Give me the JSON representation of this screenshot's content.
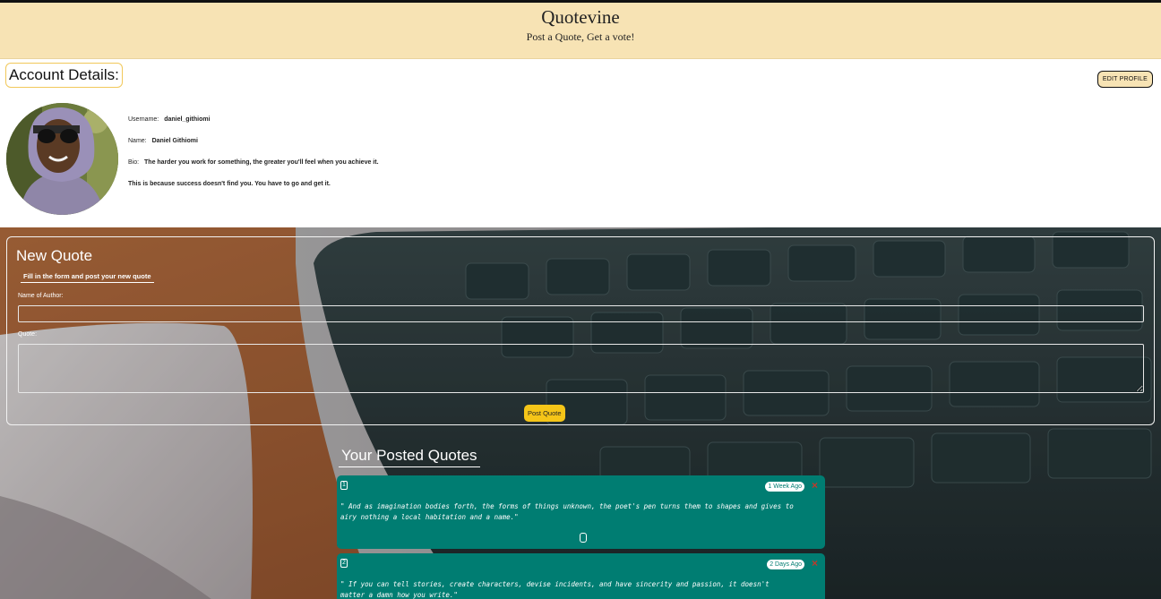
{
  "header": {
    "title": "Quotevine",
    "tagline": "Post a Quote, Get a vote!"
  },
  "account": {
    "heading": "Account Details:",
    "edit_button": "EDIT PROFILE",
    "username_label": "Username:",
    "username": "daniel_githiomi",
    "name_label": "Name:",
    "name": "Daniel Githiomi",
    "bio_label": "Bio:",
    "bio_line1": "The harder you work for something, the greater you'll feel when you achieve it.",
    "bio_line2": "This is because success doesn't find you. You have to go and get it."
  },
  "new_quote": {
    "title": "New Quote",
    "subtitle": "Fill in the form and post your new quote",
    "author_label": "Name of Author:",
    "author_value": "",
    "quote_label": "Quote:",
    "quote_value": "",
    "submit_label": "Post Quote"
  },
  "posted": {
    "title": "Your Posted Quotes",
    "quotes": [
      {
        "num": "1",
        "time": "1 Week Ago",
        "close": "×",
        "line1": "\" And as imagination bodies forth, the forms of things unknown, the poet's pen turns them to shapes and gives to",
        "line2": "airy nothing a local habitation and a name.\""
      },
      {
        "num": "2",
        "time": "2 Days Ago",
        "close": "×",
        "line1": "\" If you can tell stories, create characters, devise incidents, and have sincerity and passion, it doesn't",
        "line2": "matter a damn how you write.\""
      }
    ]
  },
  "colors": {
    "header_bg": "#f7e3b4",
    "card_bg": "#007d72",
    "button_yellow": "#f5c518",
    "close_red": "#c0392b"
  }
}
